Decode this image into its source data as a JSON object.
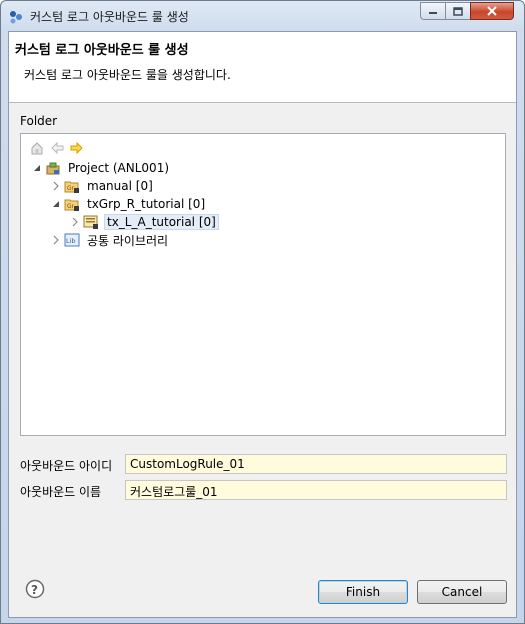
{
  "window": {
    "title": "커스텀 로그 아웃바운드 룰 생성",
    "controls": [
      "minimize",
      "maximize",
      "close"
    ]
  },
  "banner": {
    "title": "커스텀 로그 아웃바운드 룰 생성",
    "message": "커스텀 로그 아웃바운드 룰을 생성합니다."
  },
  "folder": {
    "label": "Folder",
    "toolbar": [
      "home-icon",
      "back-arrow-icon",
      "forward-arrow-icon"
    ],
    "tree": [
      {
        "label": "Project  (ANL001)",
        "expanded": true,
        "icon": "project-icon"
      },
      {
        "label": "manual [0]",
        "expanded": false,
        "icon": "group-folder-icon"
      },
      {
        "label": "txGrp_R_tutorial [0]",
        "expanded": true,
        "icon": "group-folder-icon"
      },
      {
        "label": "tx_L_A_tutorial [0]",
        "expanded": false,
        "icon": "transaction-icon",
        "selected": true
      },
      {
        "label": "공통 라이브러리",
        "expanded": false,
        "icon": "library-icon"
      }
    ]
  },
  "fields": {
    "outbound_id": {
      "label": "아웃바운드 아이디",
      "value": "CustomLogRule_01"
    },
    "outbound_name": {
      "label": "아웃바운드 이름",
      "value": "커스텀로그룰_01"
    }
  },
  "buttons": {
    "finish": "Finish",
    "cancel": "Cancel"
  },
  "colors": {
    "field_background": "#fffbdc",
    "selection": "#e4ecf7",
    "accent_arrow": "#f0b000"
  }
}
